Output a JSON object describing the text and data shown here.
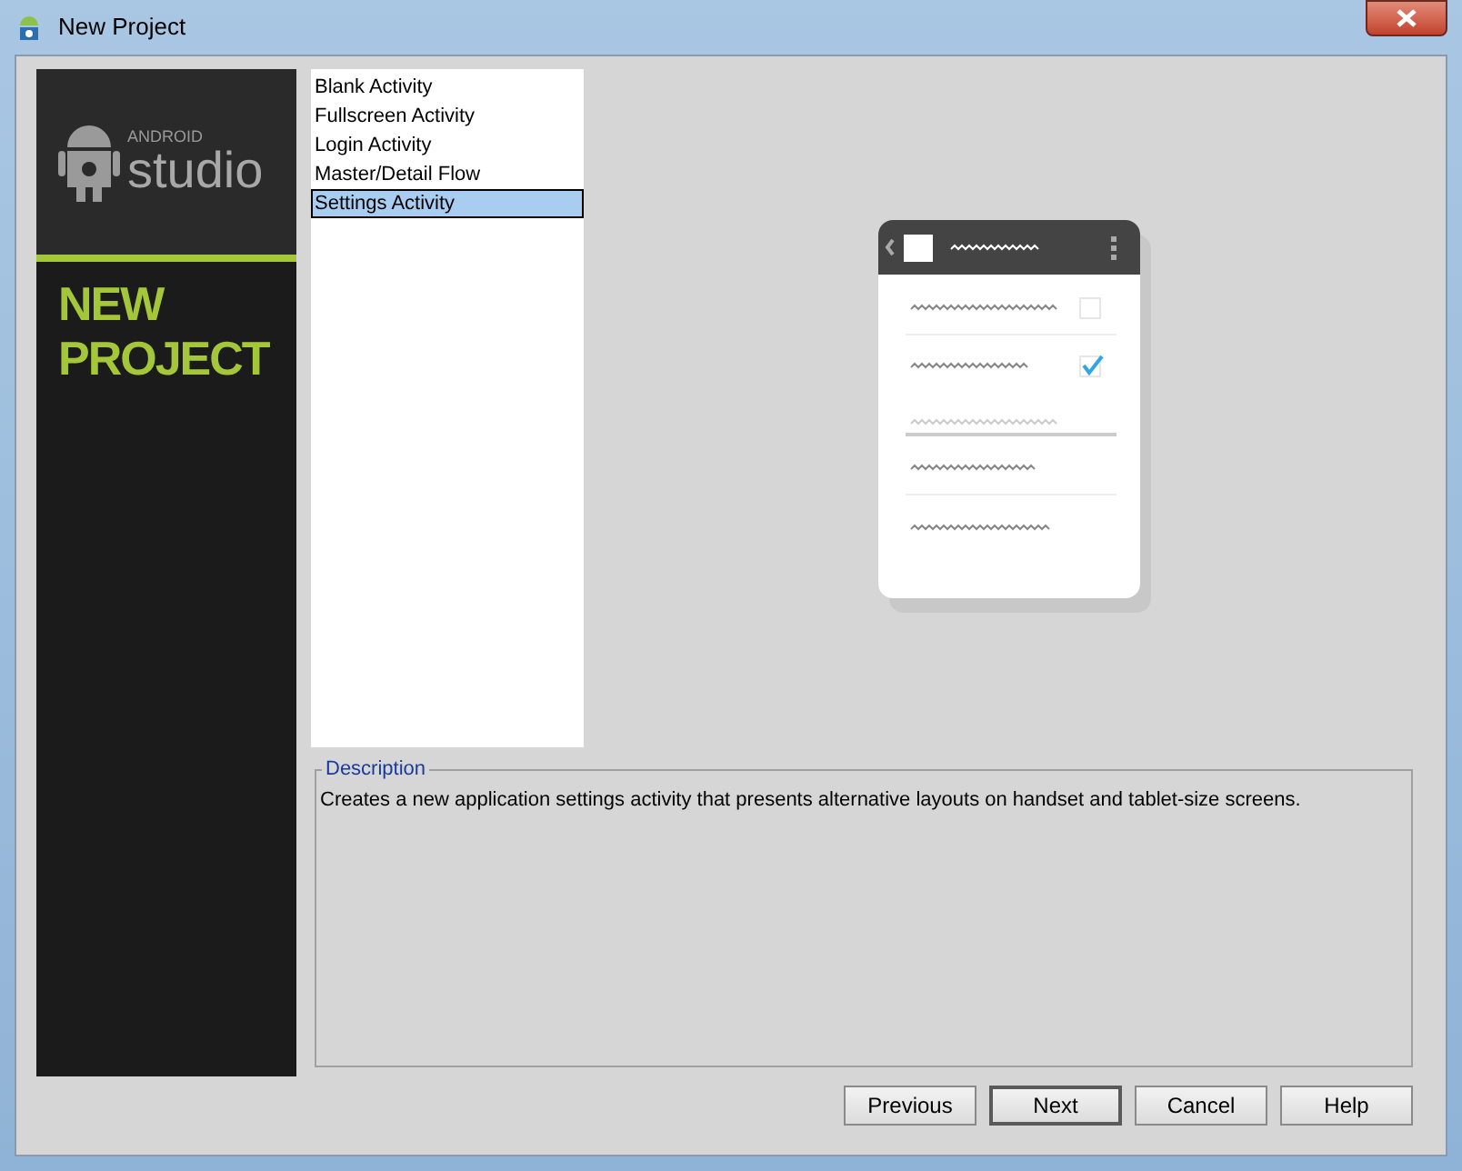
{
  "window": {
    "title": "New Project"
  },
  "banner": {
    "brand_small": "ANDROID",
    "brand_large": "studio",
    "heading_lines": [
      "NEW",
      "PROJECT"
    ]
  },
  "templates": [
    {
      "label": "Blank Activity",
      "selected": false
    },
    {
      "label": "Fullscreen Activity",
      "selected": false
    },
    {
      "label": "Login Activity",
      "selected": false
    },
    {
      "label": "Master/Detail Flow",
      "selected": false
    },
    {
      "label": "Settings Activity",
      "selected": true
    }
  ],
  "description": {
    "legend": "Description",
    "text": "Creates a new application settings activity that presents alternative layouts on handset and tablet-size screens."
  },
  "buttons": [
    {
      "label": "Previous",
      "default": false
    },
    {
      "label": "Next",
      "default": true
    },
    {
      "label": "Cancel",
      "default": false
    },
    {
      "label": "Help",
      "default": false
    }
  ]
}
